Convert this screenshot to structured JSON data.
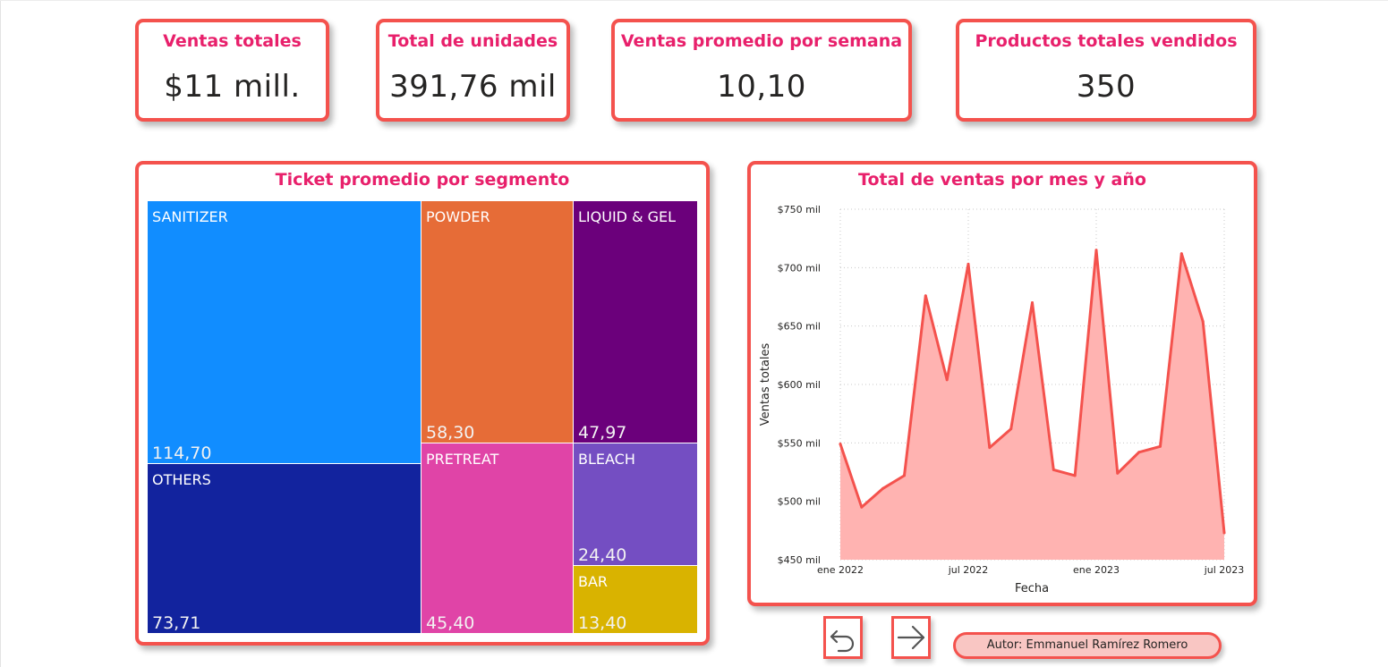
{
  "kpis": [
    {
      "title": "Ventas totales",
      "value": "$11 mill."
    },
    {
      "title": "Total de unidades",
      "value": "391,76 mil"
    },
    {
      "title": "Ventas promedio por semana",
      "value": "10,10"
    },
    {
      "title": "Productos totales vendidos",
      "value": "350"
    }
  ],
  "treemap": {
    "title": "Ticket promedio por segmento",
    "tiles": [
      {
        "label": "SANITIZER",
        "value": "114,70",
        "color": "#118dff"
      },
      {
        "label": "OTHERS",
        "value": "73,71",
        "color": "#12239e"
      },
      {
        "label": "POWDER",
        "value": "58,30",
        "color": "#e66c37"
      },
      {
        "label": "PRETREAT",
        "value": "45,40",
        "color": "#e044a7"
      },
      {
        "label": "LIQUID & GEL",
        "value": "47,97",
        "color": "#6b007b"
      },
      {
        "label": "BLEACH",
        "value": "24,40",
        "color": "#744ec2"
      },
      {
        "label": "BAR",
        "value": "13,40",
        "color": "#d9b300"
      }
    ]
  },
  "chart_data": {
    "type": "area",
    "title": "Total de ventas por mes y año",
    "xlabel": "Fecha",
    "ylabel": "Ventas totales",
    "x": [
      "2022-01",
      "2022-02",
      "2022-03",
      "2022-04",
      "2022-05",
      "2022-06",
      "2022-07",
      "2022-08",
      "2022-09",
      "2022-10",
      "2022-11",
      "2022-12",
      "2023-01",
      "2023-02",
      "2023-03",
      "2023-04",
      "2023-05",
      "2023-06",
      "2023-07"
    ],
    "series": [
      {
        "values": [
          549,
          495,
          511,
          522,
          676,
          604,
          703,
          546,
          562,
          670,
          527,
          522,
          715,
          524,
          542,
          547,
          712,
          654,
          473
        ]
      }
    ],
    "x_ticks": [
      {
        "value": "2022-01",
        "label": "ene 2022"
      },
      {
        "value": "2022-07",
        "label": "jul 2022"
      },
      {
        "value": "2023-01",
        "label": "ene 2023"
      },
      {
        "value": "2023-07",
        "label": "jul 2023"
      }
    ],
    "y_ticks": [
      {
        "value": 450,
        "label": "$450 mil"
      },
      {
        "value": 500,
        "label": "$500 mil"
      },
      {
        "value": 550,
        "label": "$550 mil"
      },
      {
        "value": 600,
        "label": "$600 mil"
      },
      {
        "value": 650,
        "label": "$650 mil"
      },
      {
        "value": 700,
        "label": "$700 mil"
      },
      {
        "value": 750,
        "label": "$750 mil"
      }
    ],
    "ylim": [
      450,
      750
    ],
    "grid": true,
    "line_color": "#f4524d",
    "fill_color": "#ffb3b1"
  },
  "nav": {
    "back_icon": "undo-arrow-icon",
    "forward_icon": "right-arrow-icon"
  },
  "footer": {
    "author": "Autor: Emmanuel Ramírez Romero"
  },
  "theme": {
    "accent": "#f4524d",
    "title_color": "#e8206b"
  }
}
